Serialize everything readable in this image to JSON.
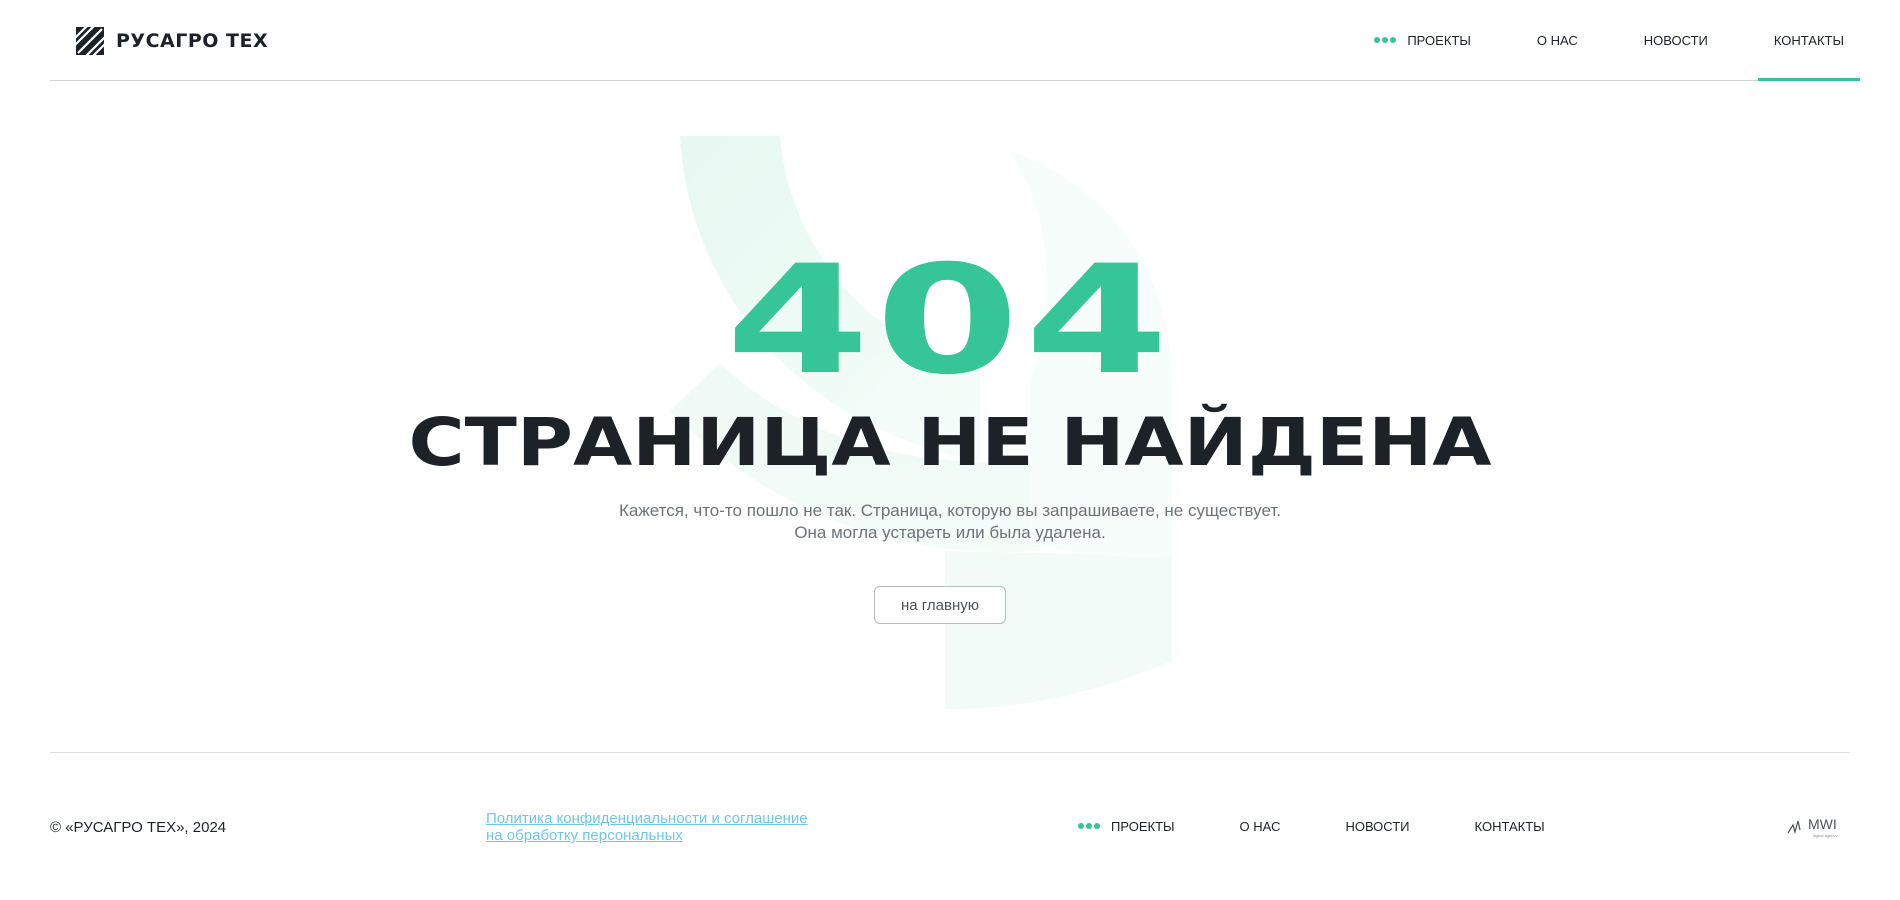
{
  "header": {
    "logo_text": "РУСАГРО ТЕХ",
    "nav": [
      {
        "label": "ПРОЕКТЫ"
      },
      {
        "label": "О НАС"
      },
      {
        "label": "НОВОСТИ"
      },
      {
        "label": "КОНТАКТЫ"
      }
    ]
  },
  "main": {
    "code": "404",
    "title": "СТРАНИЦА НЕ НАЙДЕНА",
    "description": "Кажется, что-то пошло не так. Страница, которую вы запрашиваете, не существует. Она могла устареть или была удалена.",
    "button_label": "на главную"
  },
  "footer": {
    "copyright": "© «РУСАГРО ТЕХ», 2024",
    "policy_link": "Политика конфиденциальности и соглашение на обработку персональных",
    "nav": [
      {
        "label": "ПРОЕКТЫ"
      },
      {
        "label": "О НАС"
      },
      {
        "label": "НОВОСТИ"
      },
      {
        "label": "КОНТАКТЫ"
      }
    ],
    "agency_logo_text": "MWI",
    "agency_subtext": "digital agency"
  },
  "colors": {
    "accent": "#36c596",
    "text": "#1c2228",
    "muted": "#6c7379",
    "link": "#6fc7e6",
    "bg_shape": "#eefaf5"
  },
  "icons": {
    "logo": "rusagro-logo-icon",
    "nav_dots": "dots-icon",
    "agency": "mwi-logo-icon"
  }
}
